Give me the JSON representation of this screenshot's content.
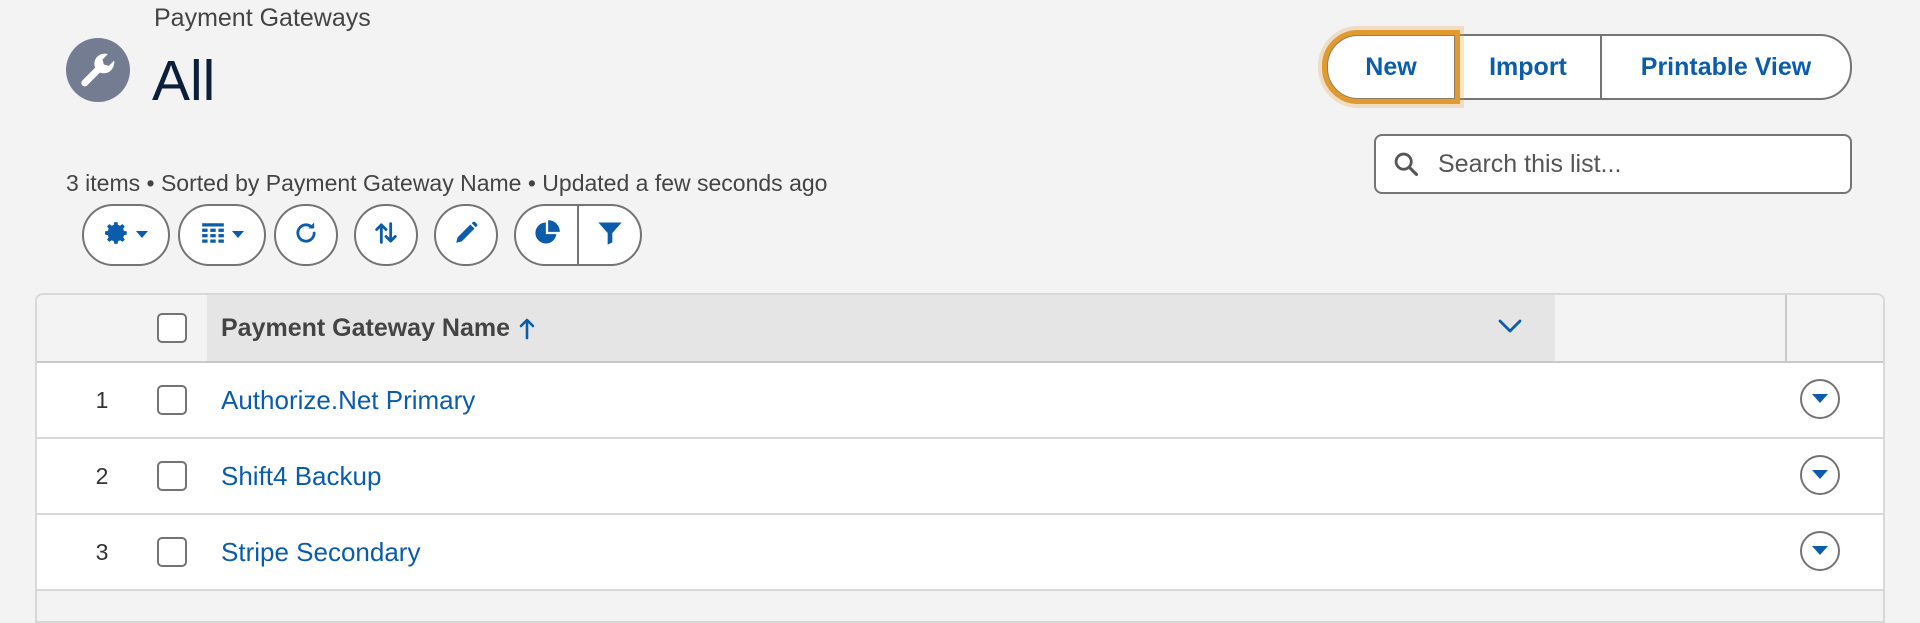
{
  "header": {
    "breadcrumb": "Payment Gateways",
    "title": "All",
    "icon": "wrench-icon"
  },
  "actions": {
    "new_label": "New",
    "import_label": "Import",
    "printable_label": "Printable View"
  },
  "meta": {
    "summary": "3 items • Sorted by Payment Gateway Name • Updated a few seconds ago"
  },
  "search": {
    "placeholder": "Search this list..."
  },
  "toolbar": {
    "icons": [
      "gear-icon",
      "table-icon",
      "refresh-icon",
      "sort-icon",
      "pencil-icon",
      "pie-chart-icon",
      "filter-icon"
    ]
  },
  "table": {
    "column_header": "Payment Gateway Name",
    "rows": [
      {
        "num": "1",
        "name": "Authorize.Net Primary"
      },
      {
        "num": "2",
        "name": "Shift4 Backup"
      },
      {
        "num": "3",
        "name": "Stripe Secondary"
      }
    ]
  },
  "colors": {
    "accent": "#0b5cab",
    "highlight": "#e09a30",
    "icon_bg": "#747c92"
  }
}
